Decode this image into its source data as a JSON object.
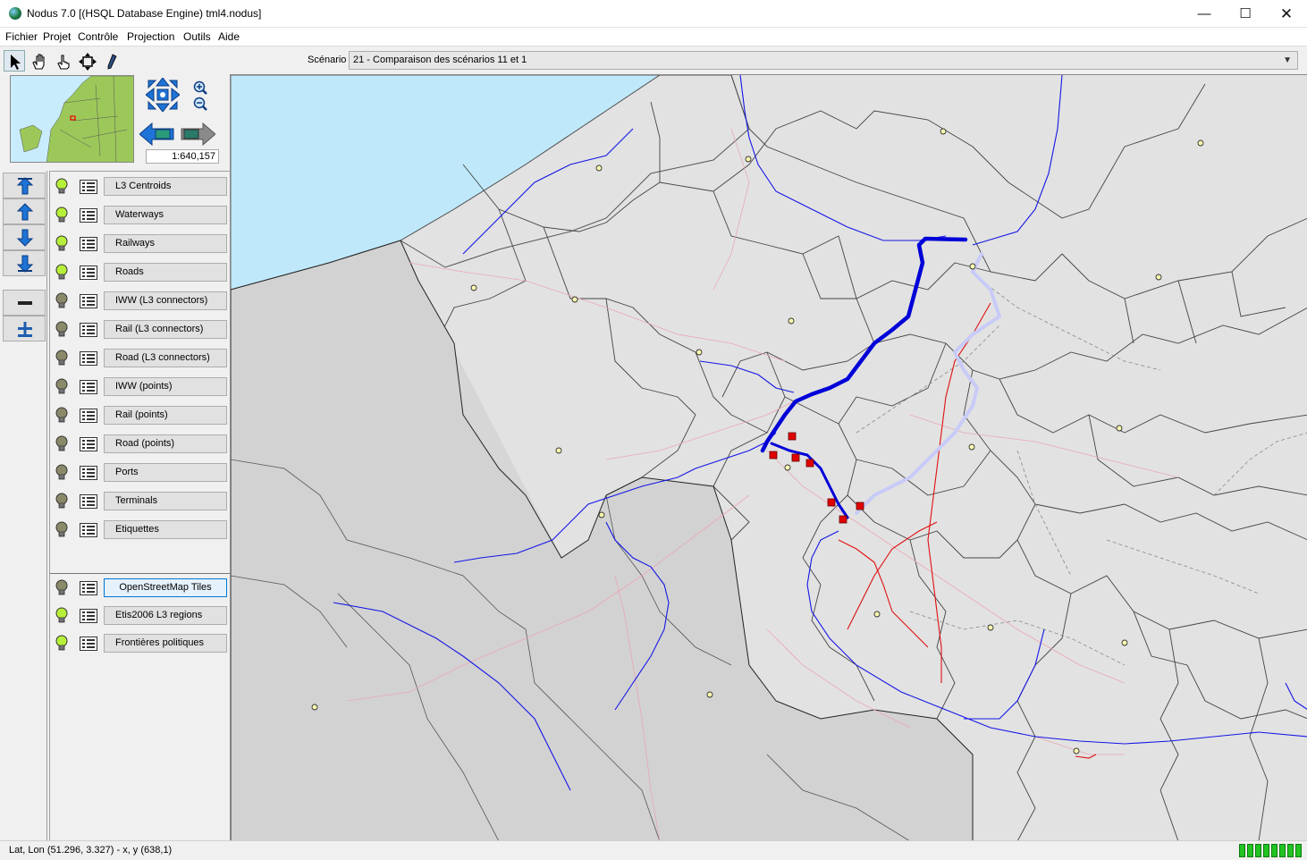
{
  "window": {
    "title": "Nodus 7.0 [(HSQL Database Engine) tml4.nodus]",
    "minimize": "—",
    "maximize": "☐",
    "close": "✕"
  },
  "menu": [
    "Fichier",
    "Projet",
    "Contrôle",
    "Projection",
    "Outils",
    "Aide"
  ],
  "toolbar": {
    "tools": [
      "select-arrow-icon",
      "pan-hand-icon",
      "pointer-hand-icon",
      "zoom-extent-icon",
      "edit-pen-icon"
    ],
    "scenario_label": "Scénario",
    "scenario_value": "21 - Comparaison des scénarios 11 et 1"
  },
  "navigation": {
    "scale": "1:640,157"
  },
  "layers": [
    {
      "name": "L3 Centroids",
      "visible": true
    },
    {
      "name": "Waterways",
      "visible": true
    },
    {
      "name": "Railways",
      "visible": true
    },
    {
      "name": "Roads",
      "visible": true
    },
    {
      "name": "IWW (L3 connectors)",
      "visible": false
    },
    {
      "name": "Rail (L3 connectors)",
      "visible": false
    },
    {
      "name": "Road (L3 connectors)",
      "visible": false
    },
    {
      "name": "IWW (points)",
      "visible": false
    },
    {
      "name": "Rail (points)",
      "visible": false
    },
    {
      "name": "Road (points)",
      "visible": false
    },
    {
      "name": "Ports",
      "visible": false
    },
    {
      "name": "Terminals",
      "visible": false
    },
    {
      "name": "Etiquettes",
      "visible": false
    }
  ],
  "background_layers": [
    {
      "name": "OpenStreetMap Tiles",
      "visible": false,
      "selected": true
    },
    {
      "name": "Etis2006 L3 regions",
      "visible": true
    },
    {
      "name": "Frontières politiques",
      "visible": true
    }
  ],
  "colors": {
    "sea": "#bfe9fb",
    "land": "#d6d6d6",
    "region": "#e2e2e2",
    "waterway": "#1515e6",
    "flow": "#0000d8",
    "rail": "#e01010",
    "bulb_on": "#b7f03a",
    "bulb_off": "#8a8a6a",
    "terminal": "#e00000"
  },
  "status": {
    "coords": "Lat, Lon (51.296, 3.327) - x, y (638,1)"
  }
}
